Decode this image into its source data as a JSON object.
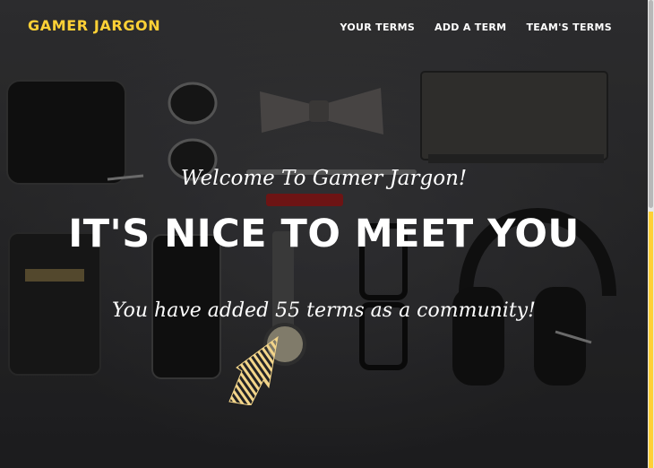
{
  "brand": {
    "name": "GAMER JARGON"
  },
  "nav": {
    "items": [
      {
        "label": "YOUR TERMS"
      },
      {
        "label": "ADD A TERM"
      },
      {
        "label": "TEAM'S TERMS"
      }
    ]
  },
  "hero": {
    "welcome": "Welcome To Gamer Jargon!",
    "heading": "IT'S NICE TO MEET YOU",
    "community": "You have added 55 terms as a community!"
  },
  "colors": {
    "accent": "#fed136",
    "text": "#ffffff",
    "background": "#2b2b2d"
  },
  "icons": {
    "cursor": "hand-pointer-icon"
  }
}
